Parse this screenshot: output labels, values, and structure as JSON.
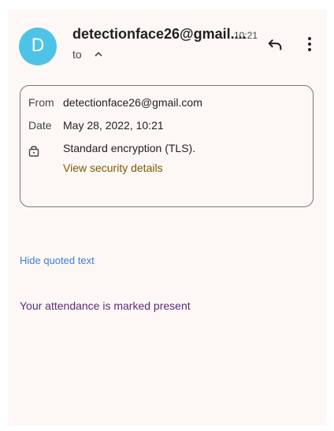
{
  "header": {
    "avatar_letter": "D",
    "sender": "detectionface26@gmail....",
    "time": "10:21",
    "to_label": "to",
    "caret_icon": "chevron-up-icon",
    "reply_icon": "reply-icon",
    "more_icon": "more-vert-icon"
  },
  "details": {
    "from_label": "From",
    "from_value": "detectionface26@gmail.com",
    "date_label": "Date",
    "date_value": "May 28, 2022, 10:21",
    "lock_icon": "lock-icon",
    "encryption": "Standard encryption (TLS).",
    "security_link": "View security details"
  },
  "body": {
    "hide_quoted": "Hide quoted text",
    "message": "Your attendance is marked present"
  },
  "colors": {
    "avatar_bg": "#4fc3e6",
    "link": "#3b7dd8",
    "security_link": "#7a5a00",
    "message_text": "#5a2d78",
    "background": "#fdf8f6"
  }
}
